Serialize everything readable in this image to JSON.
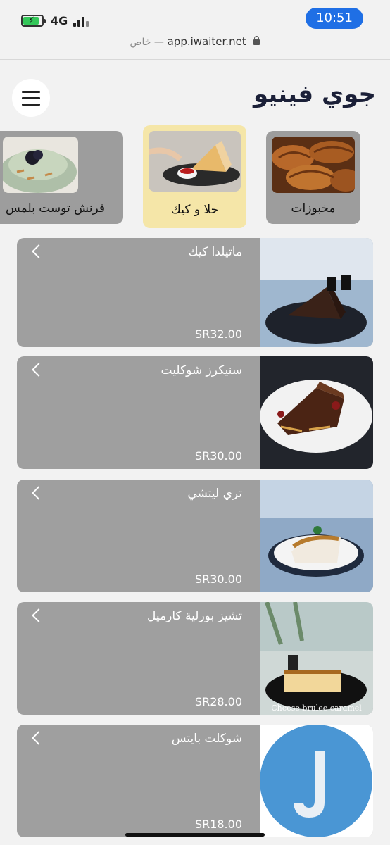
{
  "status_bar": {
    "network": "4G",
    "time": "10:51"
  },
  "url_bar": {
    "url": "app.iwaiter.net",
    "private_label": "خاص —"
  },
  "header": {
    "brand": "جوي فينيو"
  },
  "categories": [
    {
      "label": "مخبوزات",
      "icon": "croissant-photo",
      "active": false
    },
    {
      "label": "حلا و كيك",
      "icon": "cake-photo",
      "active": true
    },
    {
      "label": "فرنش توست بلمس",
      "icon": "french-toast-photo",
      "active": false
    }
  ],
  "products": [
    {
      "name": "ماتيلدا كيك",
      "price": "SR32.00",
      "image": "chocolate-cake-photo"
    },
    {
      "name": "سنيكرز شوكليت",
      "price": "SR30.00",
      "image": "snickers-chocolate-photo"
    },
    {
      "name": "تري ليتشي",
      "price": "SR30.00",
      "image": "tres-leches-photo"
    },
    {
      "name": "تشيز بورلية كارميل",
      "price": "SR28.00",
      "image": "cheese-brulee-photo",
      "image_caption": "Cheese brulee caramel"
    },
    {
      "name": "شوكلت بايتس",
      "price": "SR18.00",
      "image": "brand-logo-j"
    }
  ],
  "colors": {
    "accent": "#f5e6a8",
    "card": "#9f9f9f",
    "time_pill": "#1f6fe5",
    "logo_blue": "#4a96d4"
  }
}
